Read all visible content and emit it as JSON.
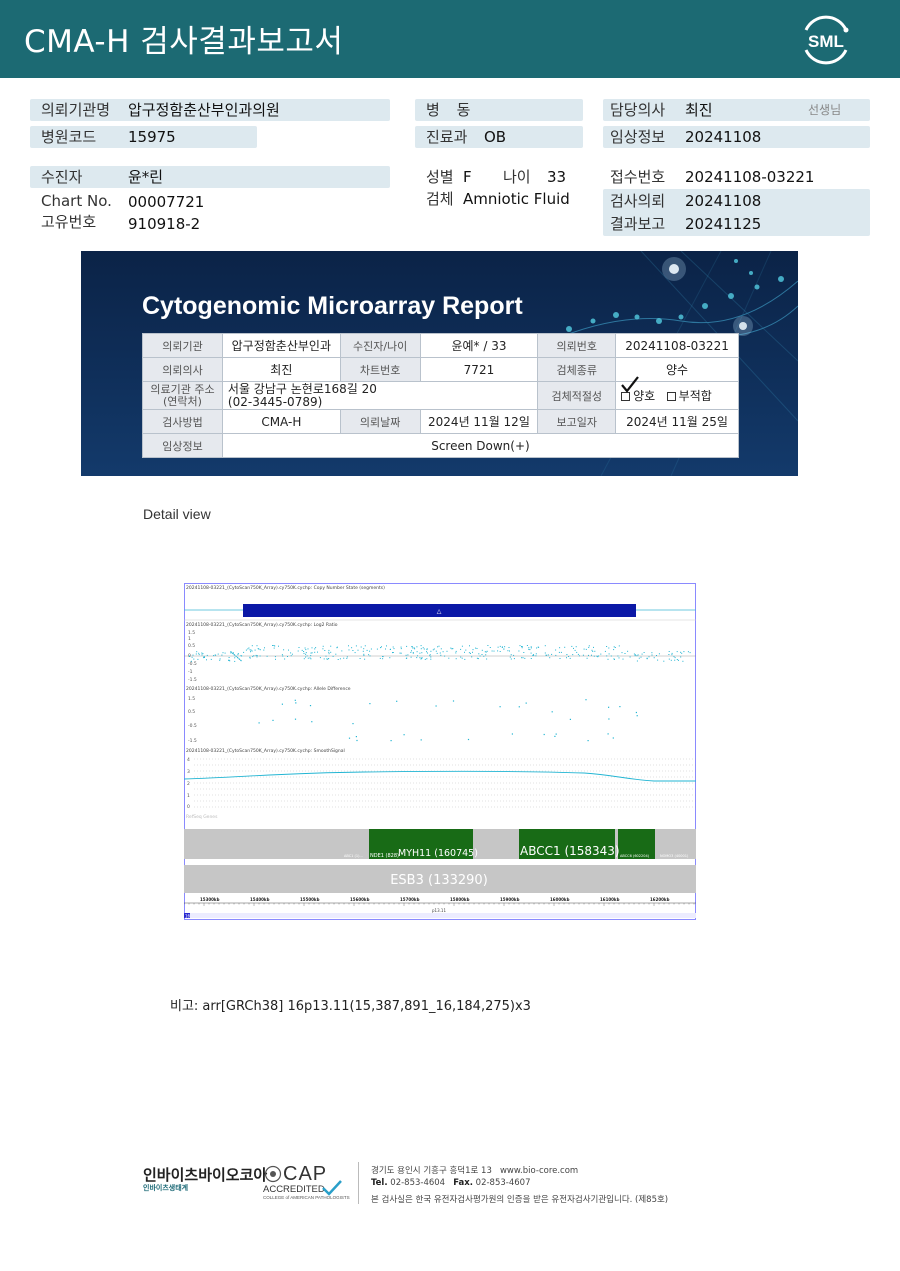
{
  "header": {
    "title": "CMA-H 검사결과보고서",
    "logo_text": "SML",
    "color": "#1c6a73"
  },
  "info": {
    "institution_label": "의뢰기관명",
    "institution": "압구정함춘산부인과의원",
    "hospital_code_label": "병원코드",
    "hospital_code": "15975",
    "patient_label": "수진자",
    "patient": "윤*린",
    "chart_label": "Chart No.",
    "chart_no": "00007721",
    "unique_label": "고유번호",
    "unique_no": "910918-2",
    "ward_label": "병 동",
    "ward": "",
    "dept_label": "진료과",
    "dept": "OB",
    "sex_label": "성별",
    "sex": "F",
    "age_label": "나이",
    "age": "33",
    "specimen_label": "검체",
    "specimen": "Amniotic Fluid",
    "doctor_label": "담당의사",
    "doctor": "최진",
    "doctor_suffix": "선생님",
    "clinical_label": "임상정보",
    "clinical": "20241108",
    "receipt_label": "접수번호",
    "receipt": "20241108-03221",
    "request_label": "검사의뢰",
    "request_date": "20241108",
    "result_label": "결과보고",
    "result_date": "20241125"
  },
  "report": {
    "title": "Cytogenomic Microarray Report",
    "r1": [
      "의뢰기관",
      "압구정함춘산부인과",
      "수진자/나이",
      "윤예* / 33",
      "의뢰번호",
      "20241108-03221"
    ],
    "r2": [
      "의뢰의사",
      "최진",
      "차트번호",
      "7721",
      "검체종류",
      "양수"
    ],
    "r3_label": "의료기관 주소\n(연락처)",
    "r3_addr1": "서울 강남구 논현로168길 20",
    "r3_addr2": "(02-3445-0789)",
    "r3_suit_label": "검체적절성",
    "r3_good": "양호",
    "r3_bad": "부적합",
    "r4": [
      "검사방법",
      "CMA-H",
      "의뢰날짜",
      "2024년 11월 12일",
      "보고일자",
      "2024년 11월 25일"
    ],
    "r5_label": "임상정보",
    "r5_value": "Screen Down(+)"
  },
  "detail_view": "Detail view",
  "plot": {
    "t1": "20241108-03221_(CytoScan750K_Array).cy750K.cychp: Copy Number State (segments)",
    "t2": "20241108-03221_(CytoScan750K_Array).cy750K.cychp: Log2 Ratio",
    "t3": "20241108-03221_(CytoScan750K_Array).cy750K.cychp: Allele Difference",
    "t4": "20241108-03221_(CytoScan750K_Array).cy750K.cychp: SmoothSignal",
    "refseq": "RefSeq Genes",
    "genes": {
      "g_left": "ABC1 (1)...",
      "ndel": "NDE1 (828)",
      "myh11": "MYH11 (160745)",
      "abcc1": "ABCC1 (158343)",
      "abcc6": "ABCC6 (602204)",
      "nomo3": "NOMO3 (40001)",
      "esb3": "ESB3 (133290)"
    },
    "ruler": [
      "15300kb",
      "15400kb",
      "15500kb",
      "15600kb",
      "15700kb",
      "15800kb",
      "15900kb",
      "16000kb",
      "16100kb",
      "16200kb"
    ],
    "band": "p13.11",
    "chr": "16",
    "seg_color": "#0b18a6",
    "gene_color": "#186b16"
  },
  "remark": "비고: arr[GRCh38] 16p13.11(15,387,891_16,184,275)x3",
  "footer": {
    "company": "인바이츠바이오코아",
    "company_sub": "인바이츠생태계",
    "cap_big": "CAP",
    "cap_mid": "ACCREDITED",
    "cap_small": "COLLEGE of AMERICAN PATHOLOGISTS",
    "addr": "경기도 용인시 기흥구 흥덕1로 13",
    "web": "www.bio-core.com",
    "tel_label": "Tel.",
    "tel": "02-853-4604",
    "fax_label": "Fax.",
    "fax": "02-853-4607",
    "cert": "본 검사실은 한국 유전자검사평가원의 인증을 받은 유전자검사기관입니다. (제85호)"
  }
}
